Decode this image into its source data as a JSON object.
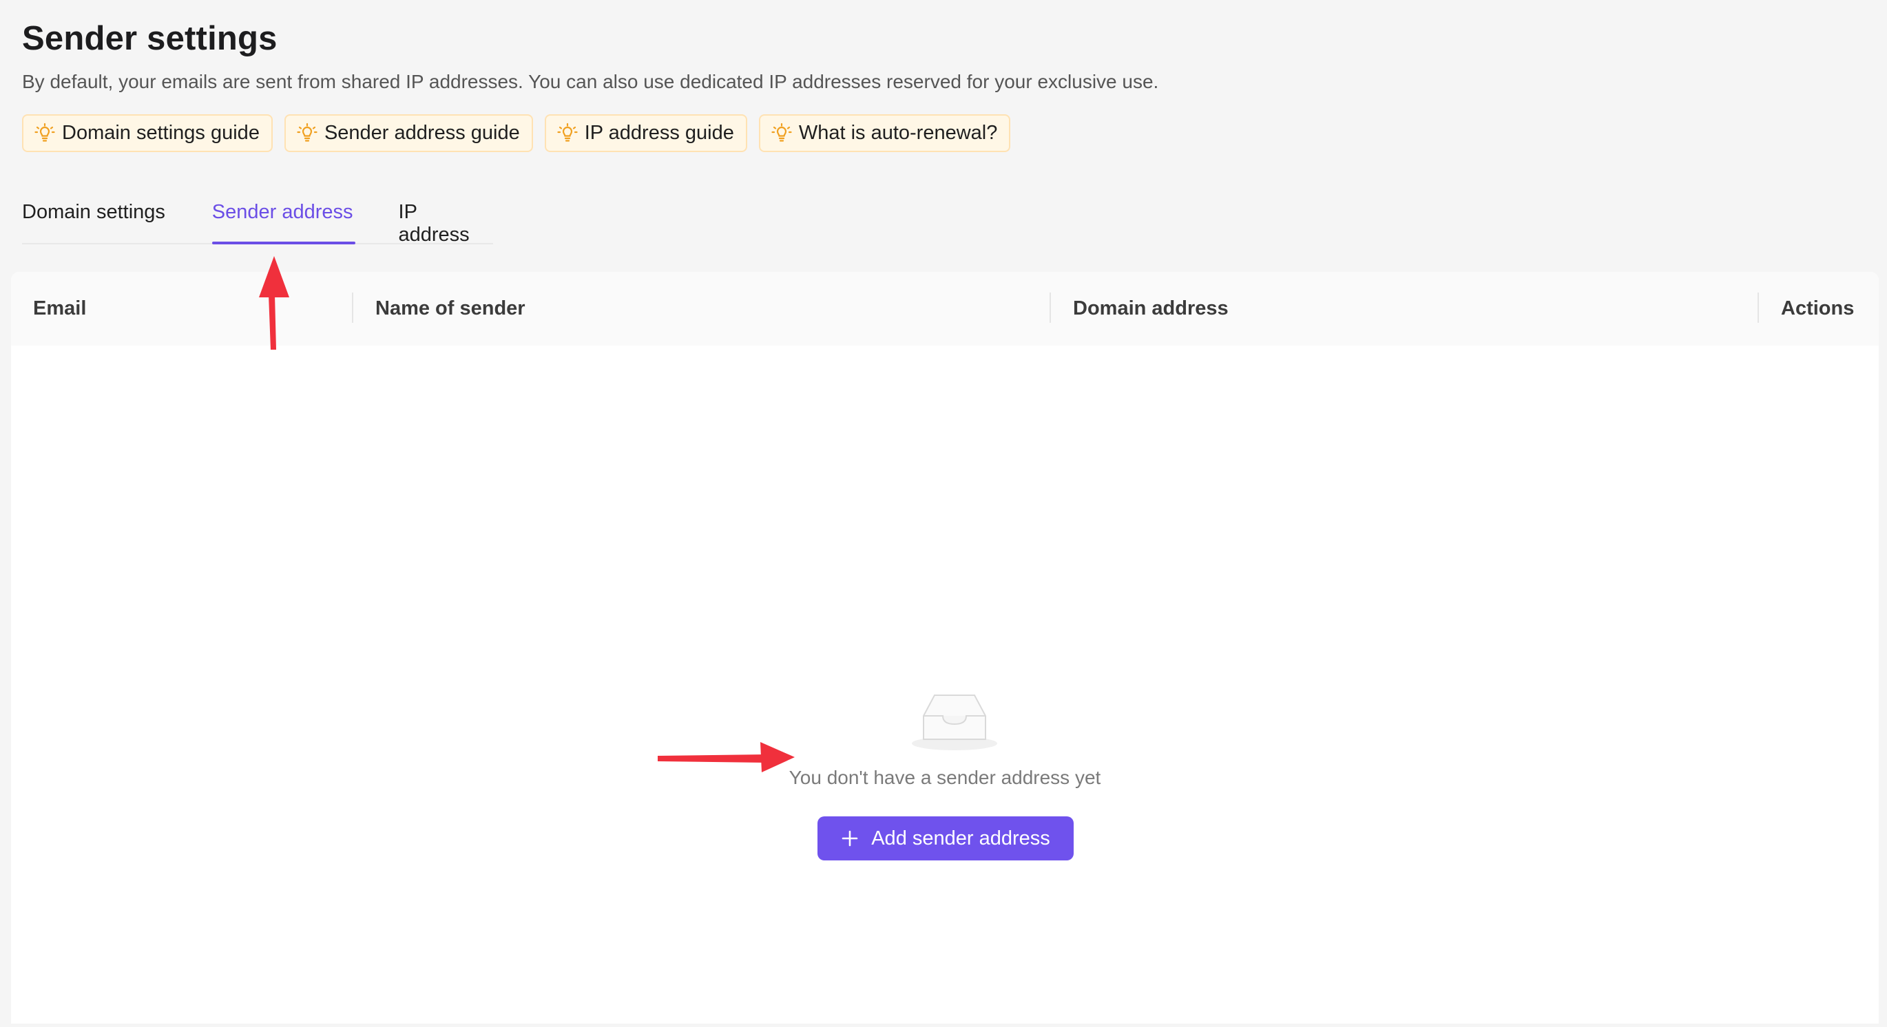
{
  "page": {
    "title": "Sender settings",
    "subtitle": "By default, your emails are sent from shared IP addresses. You can also use dedicated IP addresses reserved for your exclusive use."
  },
  "guides": [
    {
      "label": "Domain settings guide",
      "icon": "lightbulb-icon"
    },
    {
      "label": "Sender address guide",
      "icon": "lightbulb-icon"
    },
    {
      "label": "IP address guide",
      "icon": "lightbulb-icon"
    },
    {
      "label": "What is auto-renewal?",
      "icon": "lightbulb-icon"
    }
  ],
  "tabs": [
    {
      "label": "Domain settings",
      "active": false
    },
    {
      "label": "Sender address",
      "active": true
    },
    {
      "label": "IP address",
      "active": false
    }
  ],
  "table": {
    "columns": [
      "Email",
      "Name of sender",
      "Domain address",
      "Actions"
    ],
    "rows": []
  },
  "empty_state": {
    "icon": "empty-inbox-icon",
    "message": "You don't have a sender address yet",
    "button_label": "Add sender address",
    "button_icon": "plus-icon"
  },
  "colors": {
    "accent": "#6f52ed",
    "active_tab": "#6b4ee6",
    "guide_bg": "#fff7e6",
    "guide_border": "#ffe2b3",
    "bulb": "#f0a020",
    "annotation_arrow": "#f0303c"
  }
}
